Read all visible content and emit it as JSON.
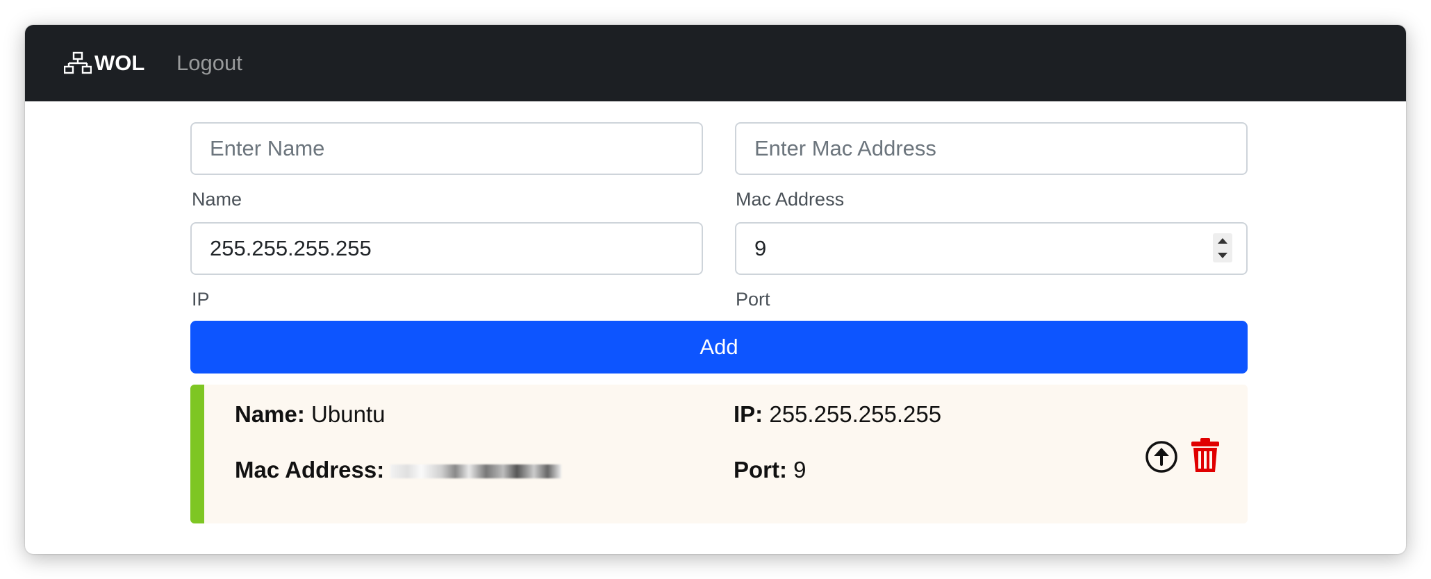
{
  "navbar": {
    "brand_label": "WOL",
    "brand_icon": "network-icon",
    "logout_label": "Logout"
  },
  "form": {
    "name_placeholder": "Enter Name",
    "name_label": "Name",
    "mac_placeholder": "Enter Mac Address",
    "mac_label": "Mac Address",
    "ip_value": "255.255.255.255",
    "ip_label": "IP",
    "port_value": "9",
    "port_label": "Port",
    "add_label": "Add"
  },
  "devices": [
    {
      "name_key": "Name:",
      "name": "Ubuntu",
      "ip_key": "IP:",
      "ip": "255.255.255.255",
      "mac_key": "Mac Address:",
      "port_key": "Port:",
      "port": "9",
      "wake_icon": "arrow-up-circle-icon",
      "delete_icon": "trash-icon"
    }
  ],
  "colors": {
    "navbar": "#1c1f23",
    "primary": "#0d55ff",
    "card_accent": "#7ec623",
    "card_bg": "#fdf8f1",
    "delete": "#e00000"
  }
}
